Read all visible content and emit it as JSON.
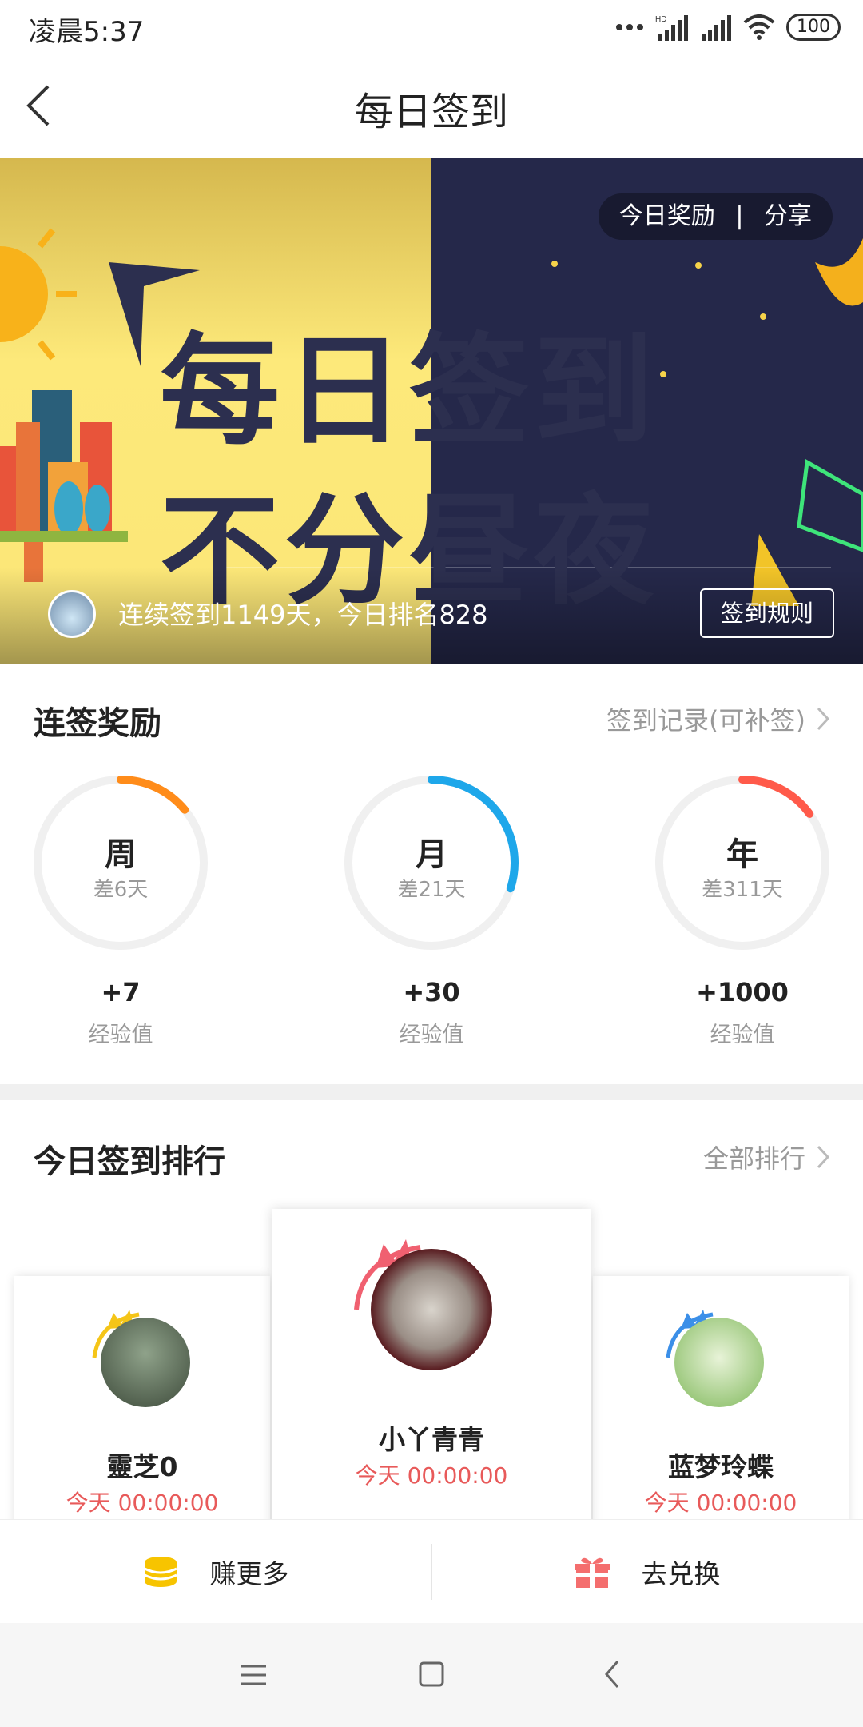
{
  "status": {
    "time": "凌晨5:37",
    "hd": "HD",
    "battery": "100"
  },
  "nav": {
    "title": "每日签到"
  },
  "banner": {
    "line1": "每日签到",
    "line2": "不分昼夜",
    "reward_label": "今日奖励",
    "separator": "|",
    "share_label": "分享",
    "streak_text": "连续签到1149天，今日排名828",
    "rules_label": "签到规则",
    "colors": {
      "left_bg": "#fbe677",
      "right_bg": "#25284a",
      "text": "#2c2f4f"
    }
  },
  "streak_rewards": {
    "title": "连签奖励",
    "record_link": "签到记录(可补签)",
    "items": [
      {
        "period": "周",
        "remaining": "差6天",
        "points": "+7",
        "unit": "经验值",
        "color": "#ff8c1a",
        "progress": 0.14
      },
      {
        "period": "月",
        "remaining": "差21天",
        "points": "+30",
        "unit": "经验值",
        "color": "#1ea7ea",
        "progress": 0.3
      },
      {
        "period": "年",
        "remaining": "差311天",
        "points": "+1000",
        "unit": "经验值",
        "color": "#ff5a4a",
        "progress": 0.15
      }
    ]
  },
  "ranking": {
    "title": "今日签到排行",
    "all_link": "全部排行",
    "users": [
      {
        "rank": 2,
        "name": "靈芝0",
        "time": "今天 00:00:00",
        "crown_color": "#f5c518"
      },
      {
        "rank": 1,
        "name": "小丫青青",
        "time": "今天 00:00:00",
        "crown_color": "#f06070"
      },
      {
        "rank": 3,
        "name": "蓝梦玲蝶",
        "time": "今天 00:00:00",
        "crown_color": "#3b8fe8"
      }
    ]
  },
  "actions": {
    "earn_more": "赚更多",
    "redeem": "去兑换"
  }
}
